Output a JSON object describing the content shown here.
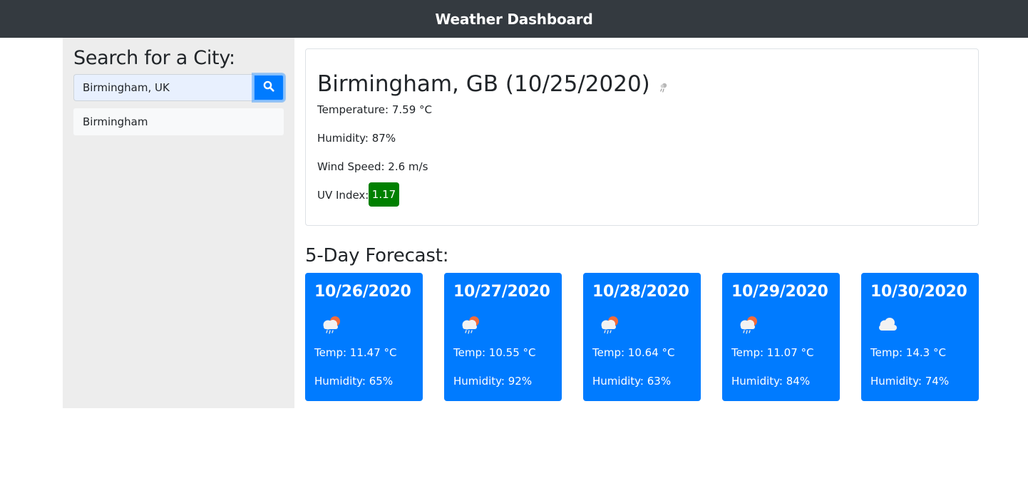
{
  "navbar": {
    "title": "Weather Dashboard"
  },
  "sidebar": {
    "heading": "Search for a City:",
    "search": {
      "value": "Birmingham, UK",
      "button_icon": "search-icon"
    },
    "history": [
      "Birmingham"
    ]
  },
  "current": {
    "title": "Birmingham, GB (10/25/2020)",
    "icon": "rain-shower-icon",
    "temperature": "Temperature: 7.59 °C",
    "humidity": "Humidity: 87%",
    "wind": "Wind Speed: 2.6 m/s",
    "uv_label": "UV Index:",
    "uv_value": "1.17",
    "uv_color": "#008000"
  },
  "forecast": {
    "heading": "5-Day Forecast:",
    "days": [
      {
        "date": "10/26/2020",
        "icon": "sun-rain-cloud-icon",
        "temp": "Temp: 11.47 °C",
        "humidity": "Humidity: 65%"
      },
      {
        "date": "10/27/2020",
        "icon": "sun-rain-cloud-icon",
        "temp": "Temp: 10.55 °C",
        "humidity": "Humidity: 92%"
      },
      {
        "date": "10/28/2020",
        "icon": "sun-rain-cloud-icon",
        "temp": "Temp: 10.64 °C",
        "humidity": "Humidity: 63%"
      },
      {
        "date": "10/29/2020",
        "icon": "sun-rain-cloud-icon",
        "temp": "Temp: 11.07 °C",
        "humidity": "Humidity: 84%"
      },
      {
        "date": "10/30/2020",
        "icon": "cloud-icon",
        "temp": "Temp: 14.3 °C",
        "humidity": "Humidity: 74%"
      }
    ]
  },
  "colors": {
    "navbar": "#343a40",
    "sidebar": "#ededed",
    "card_blue": "#007bff",
    "uv_green": "#008000"
  }
}
